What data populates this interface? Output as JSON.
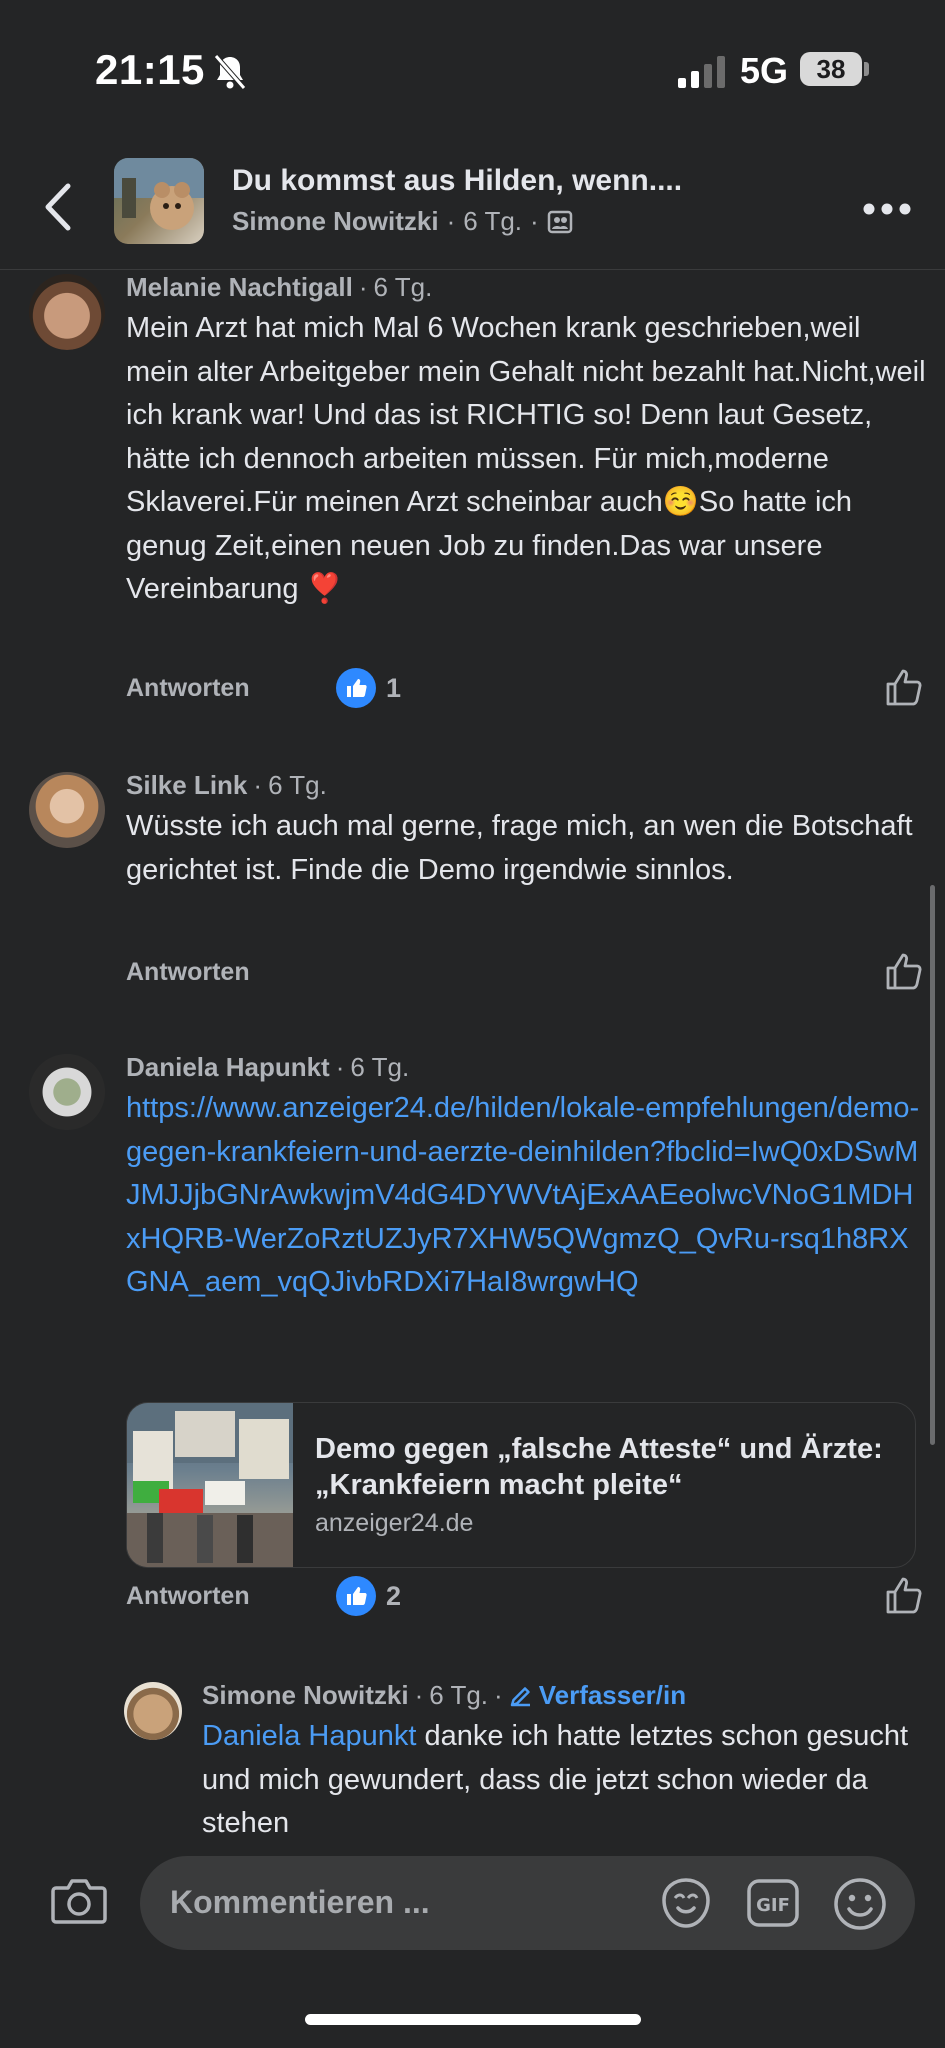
{
  "status": {
    "time": "21:15",
    "network": "5G",
    "battery": "38"
  },
  "header": {
    "title": "Du kommst aus Hilden, wenn....",
    "author": "Simone Nowitzki",
    "age": "6 Tg."
  },
  "comments": [
    {
      "author": "Melanie Nachtigall",
      "age": "6 Tg.",
      "text": "Mein Arzt hat mich Mal 6 Wochen krank geschrieben,weil mein alter Arbeitgeber mein Gehalt nicht bezahlt hat.Nicht,weil ich krank war! Und das ist RICHTIG so! Denn laut Gesetz, hätte ich dennoch arbeiten müssen. Für mich,moderne Sklaverei.Für meinen Arzt scheinbar auch☺️So hatte ich genug Zeit,einen neuen Job zu finden.Das war unsere Vereinbarung ❣️",
      "reply_label": "Antworten",
      "likes": "1"
    },
    {
      "author": "Silke Link",
      "age": "6 Tg.",
      "text": "Wüsste ich auch mal gerne, frage mich, an wen die Botschaft gerichtet ist. Finde die Demo irgendwie sinnlos.",
      "reply_label": "Antworten"
    },
    {
      "author": "Daniela Hapunkt",
      "age": "6 Tg.",
      "link": "https://www.anzeiger24.de/hilden/lokale-empfehlungen/demo-gegen-krankfeiern-und-aerzte-deinhilden?fbclid=IwQ0xDSwMJMJJjbGNrAwkwjmV4dG4DYWVtAjExAAEeolwcVNoG1MDHxHQRB-WerZoRztUZJyR7XHW5QWgmzQ_QvRu-rsq1h8RXGNA_aem_vqQJivbRDXi7HaI8wrgwHQ",
      "preview_title": "Demo gegen „falsche Atteste“ und Ärzte: „Krankfeiern macht pleite“",
      "preview_domain": "anzeiger24.de",
      "reply_label": "Antworten",
      "likes": "2"
    },
    {
      "author": "Simone Nowitzki",
      "age": "6 Tg.",
      "badge": "Verfasser/in",
      "mention": "Daniela Hapunkt",
      "text": " danke ich hatte letztes schon gesucht und mich gewundert, dass die jetzt schon wieder da stehen"
    }
  ],
  "composer": {
    "placeholder": "Kommentieren ..."
  },
  "colors": {
    "background": "#242526",
    "text": "#e4e6eb",
    "secondary": "#b0b3b8",
    "link": "#4b9cf5",
    "like": "#2e89ff"
  }
}
